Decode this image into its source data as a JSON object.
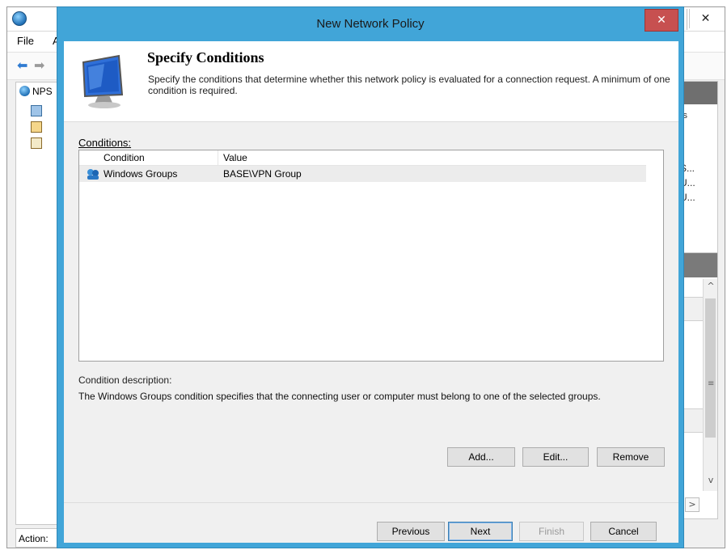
{
  "bg_window": {
    "menu": {
      "file": "File",
      "action": "A"
    },
    "tree_root": "NPS",
    "status": "Action:",
    "right_header_text": "ss",
    "right_items": [
      "S...",
      "U...",
      "U..."
    ]
  },
  "dialog": {
    "title": "New Network Policy",
    "close": "✕",
    "header": {
      "title": "Specify Conditions",
      "description": "Specify the conditions that determine whether this network policy is evaluated for a connection request. A minimum of one condition is required."
    },
    "conditions_label": "Conditions:",
    "table": {
      "columns": [
        "Condition",
        "Value"
      ],
      "rows": [
        {
          "condition": "Windows Groups",
          "value": "BASE\\VPN Group"
        }
      ]
    },
    "condition_description_label": "Condition description:",
    "condition_description": "The Windows Groups condition specifies that the connecting user or computer must belong to one of the selected groups.",
    "buttons": {
      "add": "Add...",
      "edit": "Edit...",
      "remove": "Remove",
      "previous": "Previous",
      "next": "Next",
      "finish": "Finish",
      "cancel": "Cancel"
    }
  },
  "colors": {
    "dialog_frame": "#41a5d8",
    "close_button": "#c75050",
    "selected_row": "#ececec"
  }
}
